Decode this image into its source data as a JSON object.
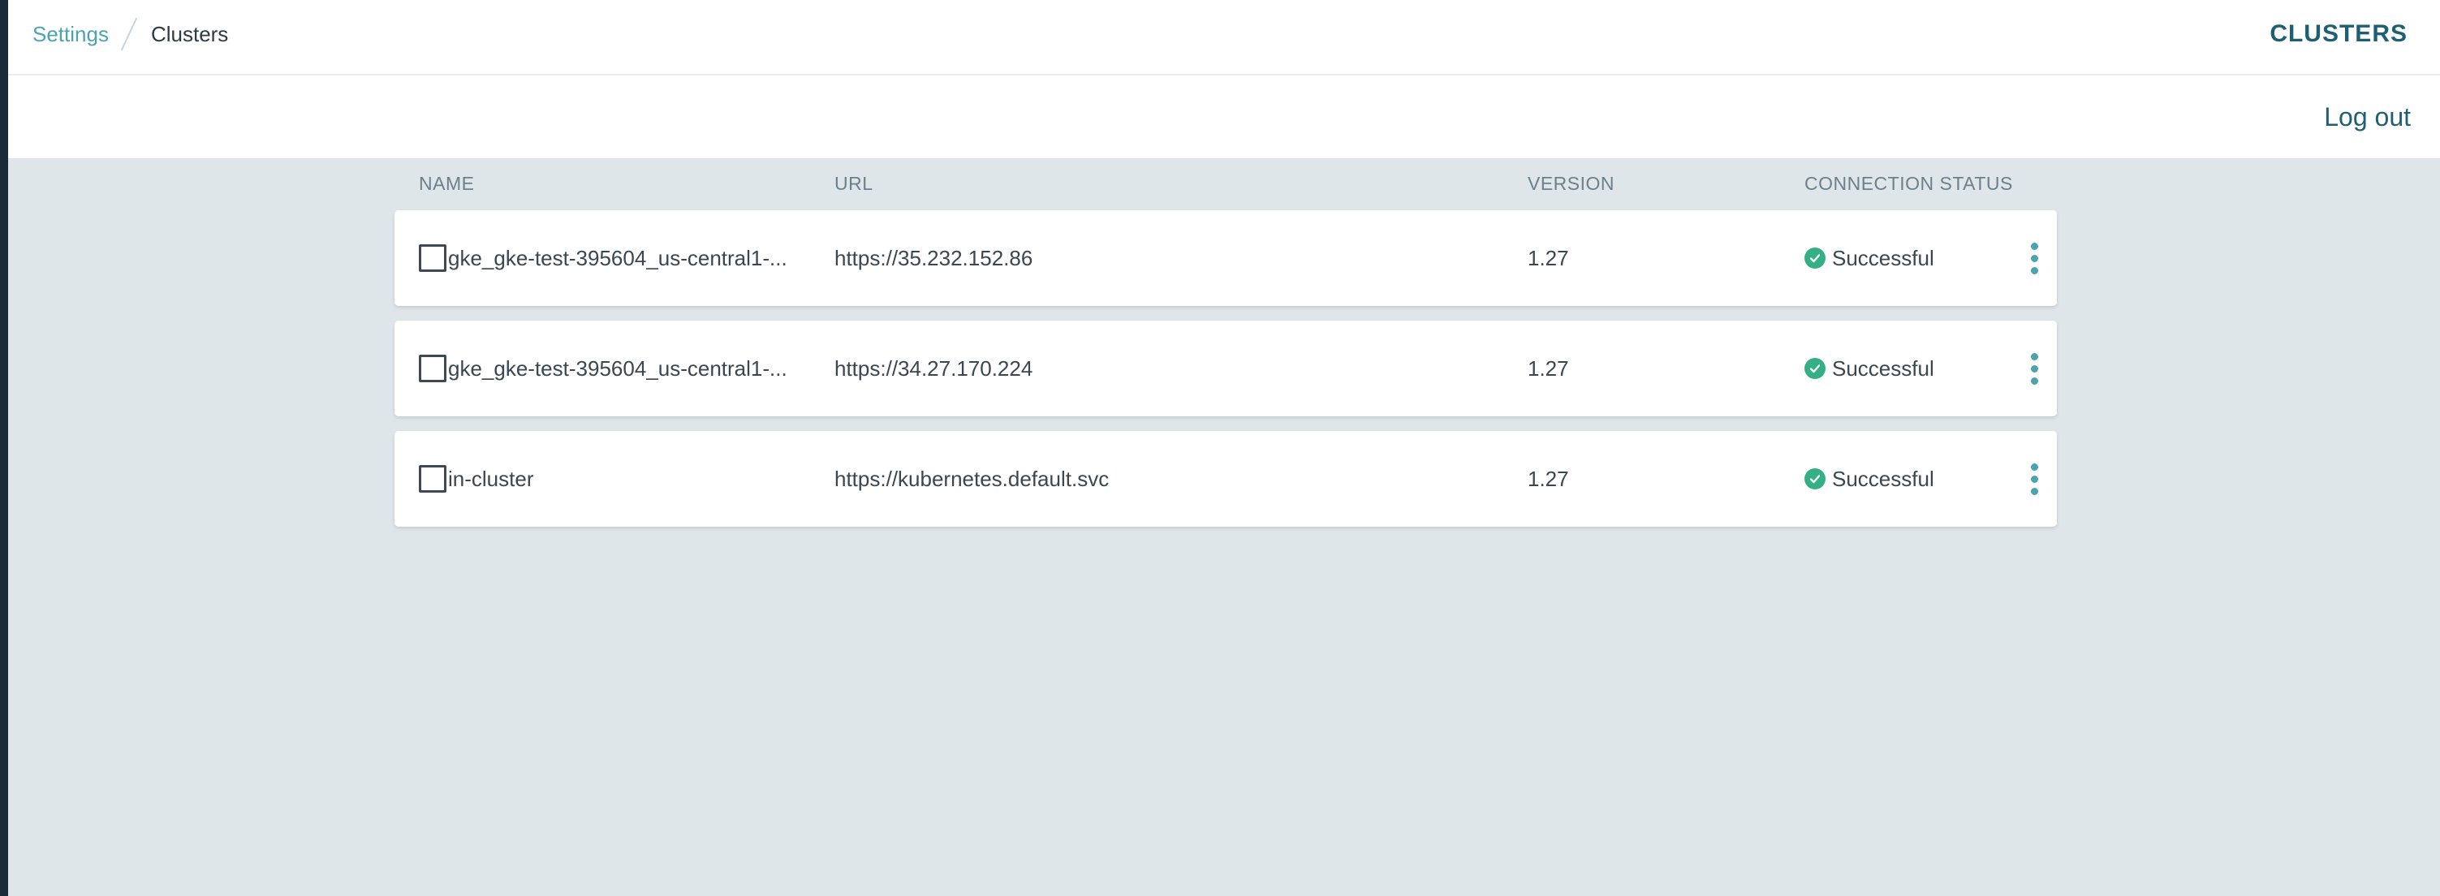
{
  "breadcrumb": {
    "parent": "Settings",
    "current": "Clusters"
  },
  "header": {
    "title": "CLUSTERS",
    "logout_label": "Log out"
  },
  "table": {
    "columns": {
      "name": "NAME",
      "url": "URL",
      "version": "VERSION",
      "status": "CONNECTION STATUS"
    },
    "rows": [
      {
        "name": "gke_gke-test-395604_us-central1-...",
        "url": "https://35.232.152.86",
        "version": "1.27",
        "status": "Successful"
      },
      {
        "name": "gke_gke-test-395604_us-central1-...",
        "url": "https://34.27.170.224",
        "version": "1.27",
        "status": "Successful"
      },
      {
        "name": "in-cluster",
        "url": "https://kubernetes.default.svc",
        "version": "1.27",
        "status": "Successful"
      }
    ]
  },
  "icons": {
    "status": "check-circle-icon",
    "menu": "more-vertical-icon"
  },
  "colors": {
    "accent": "#4ba3b0",
    "title": "#1f5f74",
    "success": "#35b086",
    "background": "#dee6ea"
  }
}
